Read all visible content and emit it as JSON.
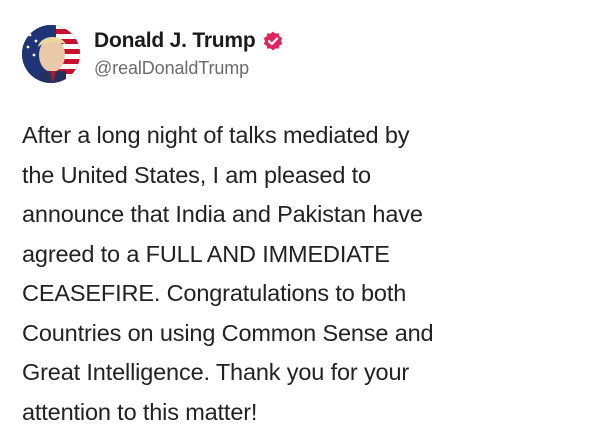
{
  "author": {
    "display_name": "Donald J. Trump",
    "handle": "@realDonaldTrump",
    "verified_color": "#e0245e",
    "avatar_icon": "profile-photo-avatar",
    "verified_icon": "verified-badge-icon"
  },
  "post": {
    "text": "After a long night of talks mediated by\nthe United States, I am pleased to\nannounce that India and Pakistan have\nagreed to a FULL AND IMMEDIATE\nCEASEFIRE. Congratulations to both\nCountries on using Common Sense and\nGreat Intelligence. Thank you for your\nattention to this matter!"
  }
}
